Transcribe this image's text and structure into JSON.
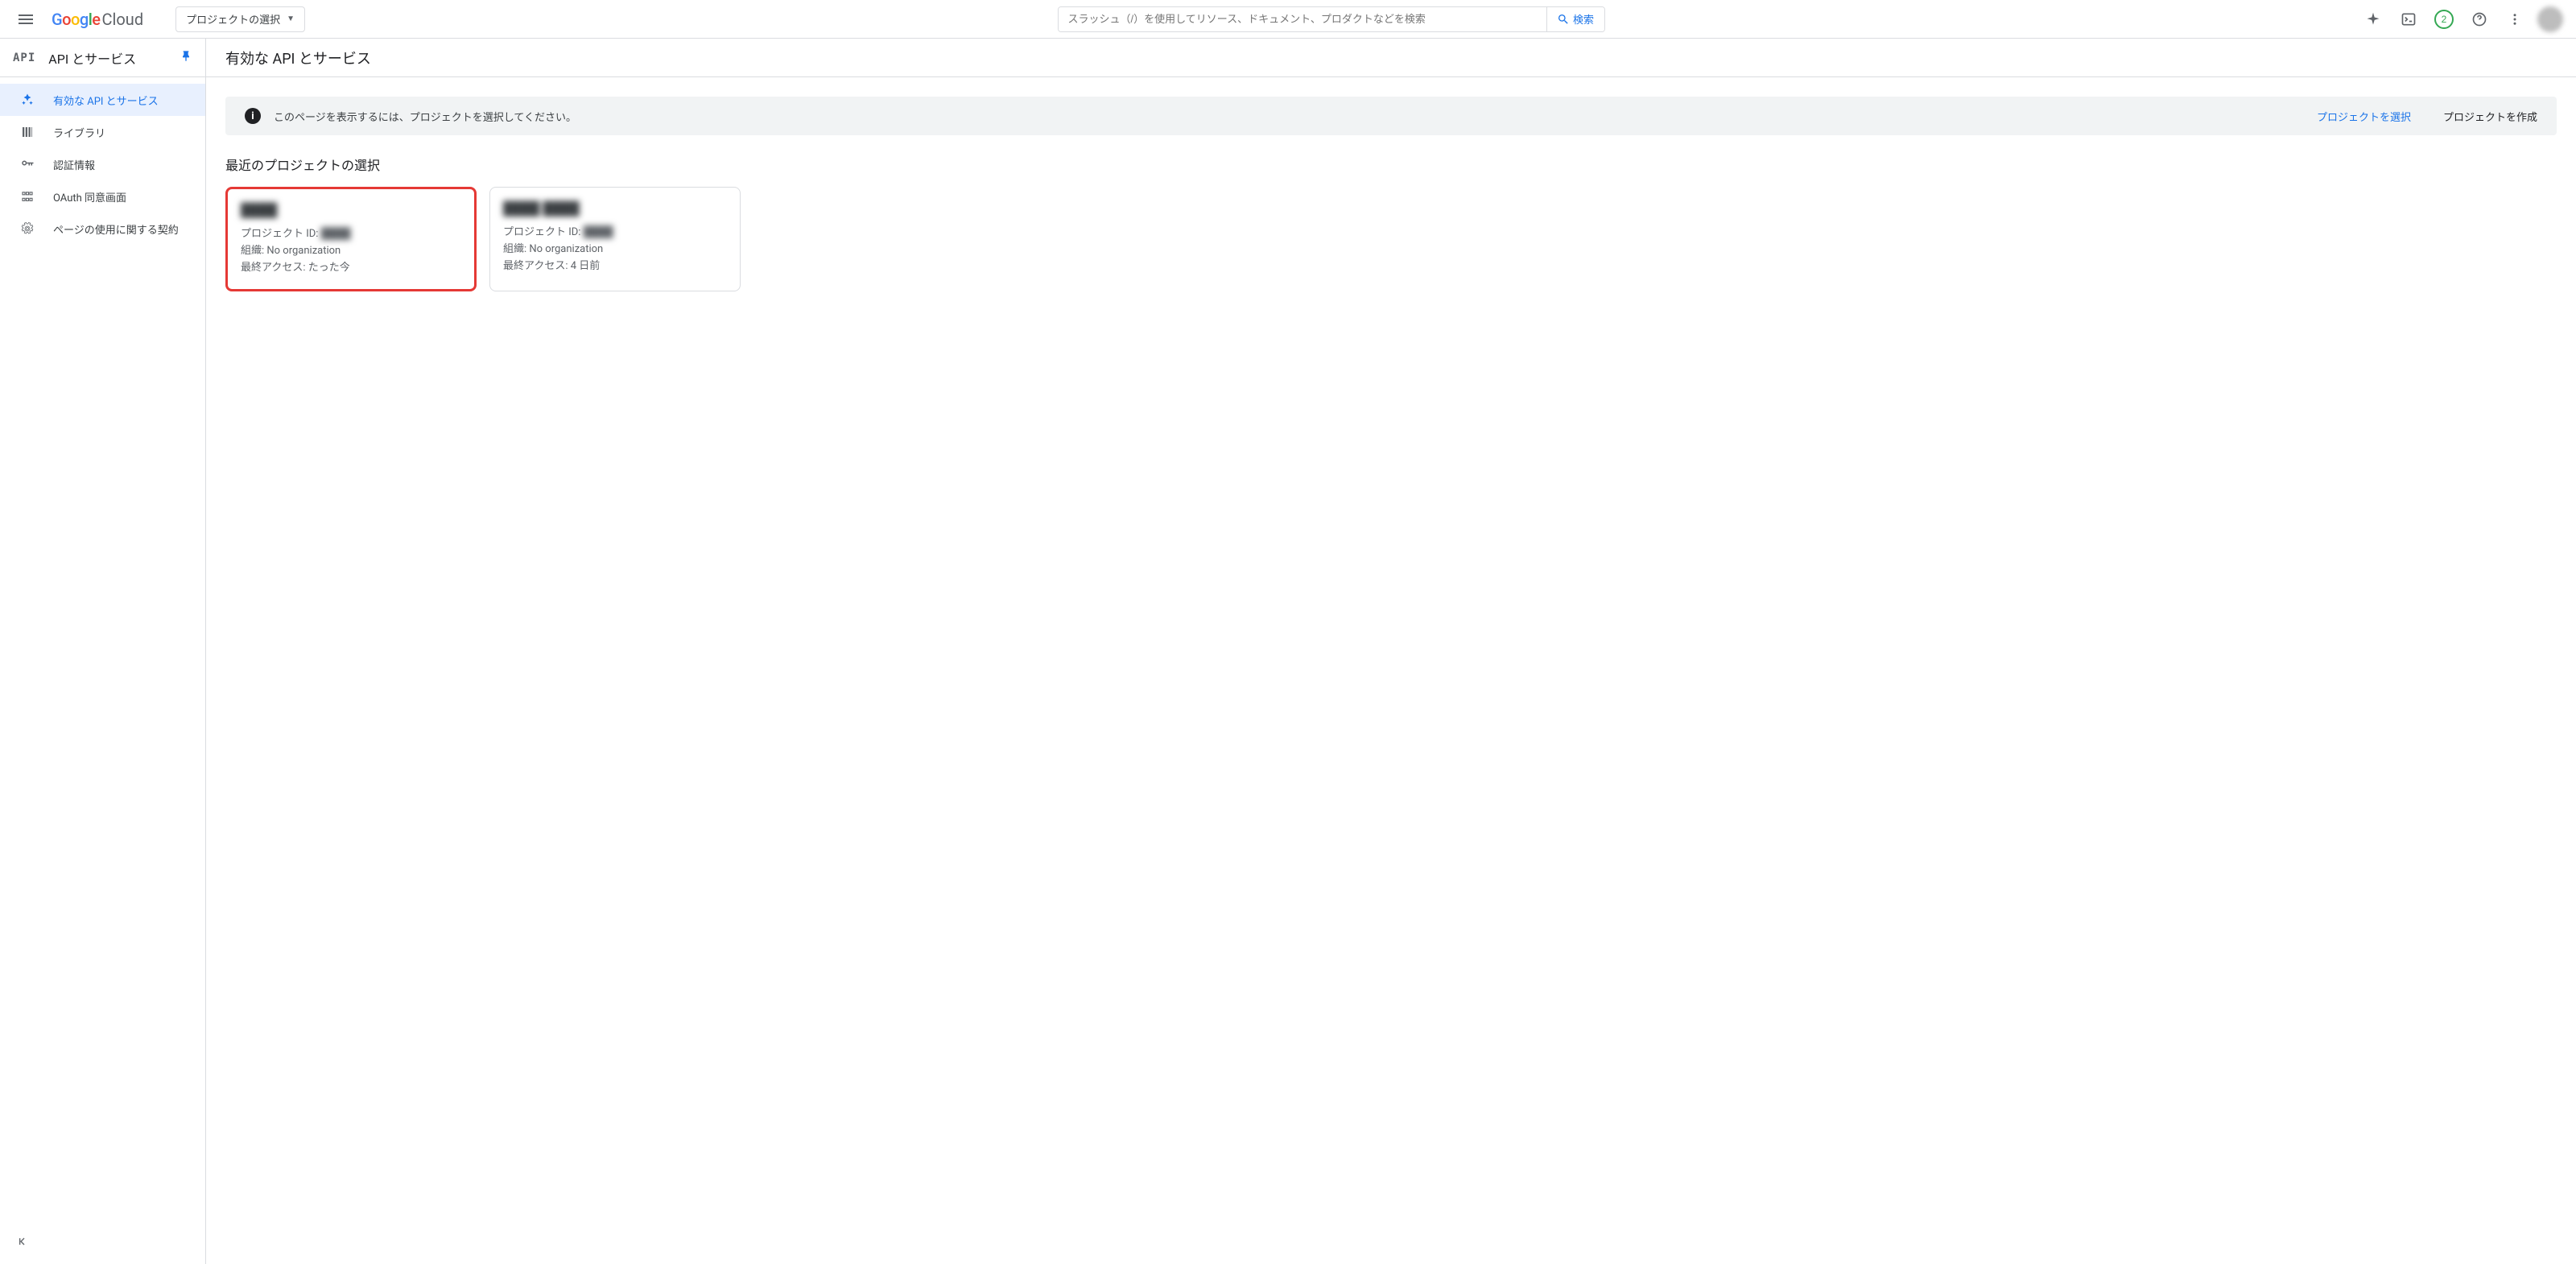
{
  "header": {
    "project_selector_label": "プロジェクトの選択",
    "search_placeholder": "スラッシュ（/）を使用してリソース、ドキュメント、プロダクトなどを検索",
    "search_button": "検索",
    "trial_count": "2"
  },
  "sidebar": {
    "badge": "API",
    "title": "API とサービス",
    "items": [
      {
        "label": "有効な API とサービス",
        "active": true
      },
      {
        "label": "ライブラリ",
        "active": false
      },
      {
        "label": "認証情報",
        "active": false
      },
      {
        "label": "OAuth 同意画面",
        "active": false
      },
      {
        "label": "ページの使用に関する契約",
        "active": false
      }
    ]
  },
  "main": {
    "title": "有効な API とサービス",
    "info_bar": {
      "text": "このページを表示するには、プロジェクトを選択してください。",
      "link": "プロジェクトを選択",
      "action": "プロジェクトを作成"
    },
    "recent_title": "最近のプロジェクトの選択",
    "labels": {
      "project_id": "プロジェクト ID:",
      "org": "組織:",
      "last_access": "最終アクセス:"
    },
    "projects": [
      {
        "name": "████",
        "id": "████",
        "org": "No organization",
        "last_access": "たった今",
        "highlighted": true
      },
      {
        "name": "████ ████",
        "id": "████",
        "org": "No organization",
        "last_access": "4 日前",
        "highlighted": false
      }
    ]
  }
}
